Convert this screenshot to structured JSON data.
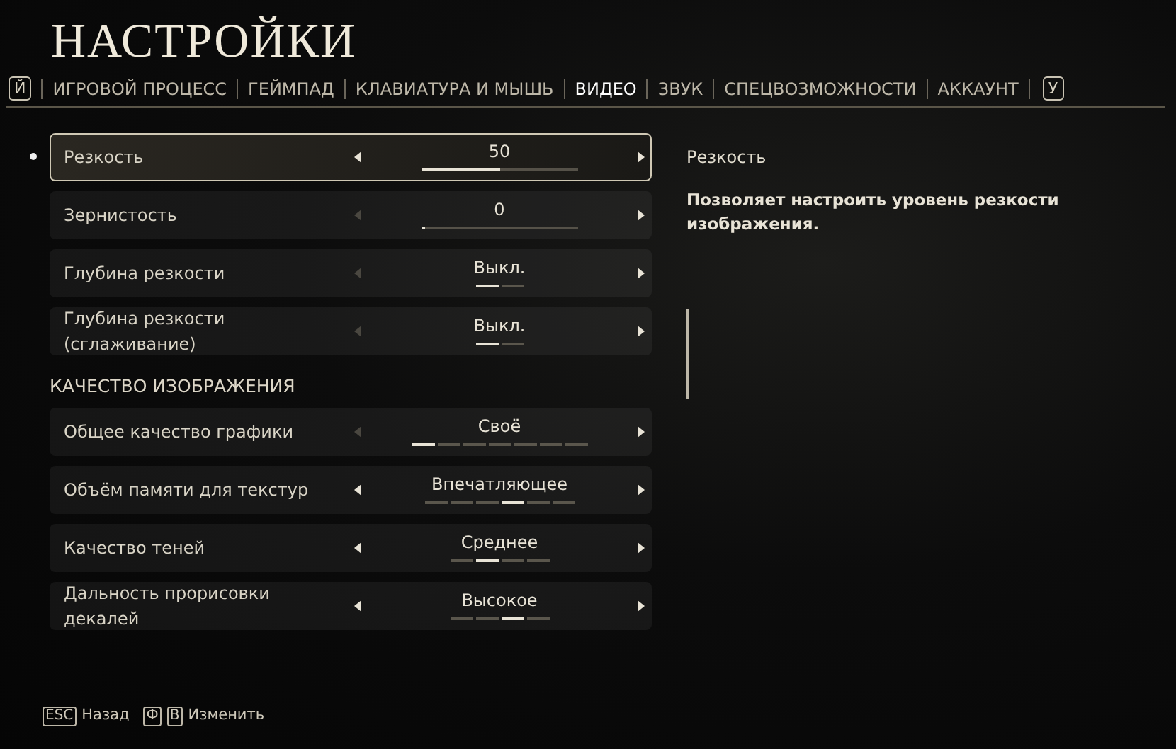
{
  "title": "НАСТРОЙКИ",
  "tab_bar": {
    "prev_key": "Й",
    "next_key": "У",
    "tabs": [
      {
        "label": "ИГРОВОЙ ПРОЦЕСС",
        "selected": false
      },
      {
        "label": "ГЕЙМПАД",
        "selected": false
      },
      {
        "label": "КЛАВИАТУРА И МЫШЬ",
        "selected": false
      },
      {
        "label": "ВИДЕО",
        "selected": true
      },
      {
        "label": "ЗВУК",
        "selected": false
      },
      {
        "label": "СПЕЦВОЗМОЖНОСТИ",
        "selected": false
      },
      {
        "label": "АККАУНТ",
        "selected": false
      }
    ]
  },
  "groups": [
    {
      "settings": [
        {
          "kind": "slider",
          "label": "Резкость",
          "value": "50",
          "level": 0.5,
          "focused": true,
          "left_disabled": false
        },
        {
          "kind": "slider",
          "label": "Зернистость",
          "value": "0",
          "level": 0.0,
          "focused": false,
          "left_disabled": true
        },
        {
          "kind": "stepper",
          "label": "Глубина резкости",
          "value": "Выкл.",
          "focused": false,
          "left_disabled": true,
          "segments": [
            {
              "selected": true
            },
            {
              "selected": false
            }
          ]
        },
        {
          "kind": "stepper",
          "label": "Глубина резкости (сглаживание)",
          "value": "Выкл.",
          "focused": false,
          "left_disabled": true,
          "segments": [
            {
              "selected": true
            },
            {
              "selected": false
            }
          ]
        }
      ]
    },
    {
      "heading": "КАЧЕСТВО ИЗОБРАЖЕНИЯ",
      "settings": [
        {
          "kind": "stepper",
          "label": "Общее качество графики",
          "value": "Своё",
          "focused": false,
          "left_disabled": true,
          "segments": [
            {
              "selected": true
            },
            {
              "selected": false
            },
            {
              "selected": false
            },
            {
              "selected": false
            },
            {
              "selected": false
            },
            {
              "selected": false
            },
            {
              "selected": false
            }
          ]
        },
        {
          "kind": "stepper",
          "label": "Объём памяти для текстур",
          "value": "Впечатляющее",
          "focused": false,
          "left_disabled": false,
          "segments": [
            {
              "selected": false
            },
            {
              "selected": false
            },
            {
              "selected": false
            },
            {
              "selected": true
            },
            {
              "selected": false
            },
            {
              "selected": false
            }
          ]
        },
        {
          "kind": "stepper",
          "label": "Качество теней",
          "value": "Среднее",
          "focused": false,
          "left_disabled": false,
          "segments": [
            {
              "selected": false
            },
            {
              "selected": true
            },
            {
              "selected": false
            },
            {
              "selected": false
            }
          ]
        },
        {
          "kind": "stepper",
          "label": "Дальность прорисовки декалей",
          "value": "Высокое",
          "focused": false,
          "left_disabled": false,
          "segments": [
            {
              "selected": false
            },
            {
              "selected": false
            },
            {
              "selected": true
            },
            {
              "selected": false
            }
          ]
        }
      ]
    }
  ],
  "detail": {
    "title": "Резкость",
    "description": "Позволяет настроить уровень резкости изображения."
  },
  "footer": [
    {
      "keys": [
        "ESC"
      ],
      "label": "Назад"
    },
    {
      "keys": [
        "Ф",
        "В"
      ],
      "label": "Изменить"
    }
  ]
}
